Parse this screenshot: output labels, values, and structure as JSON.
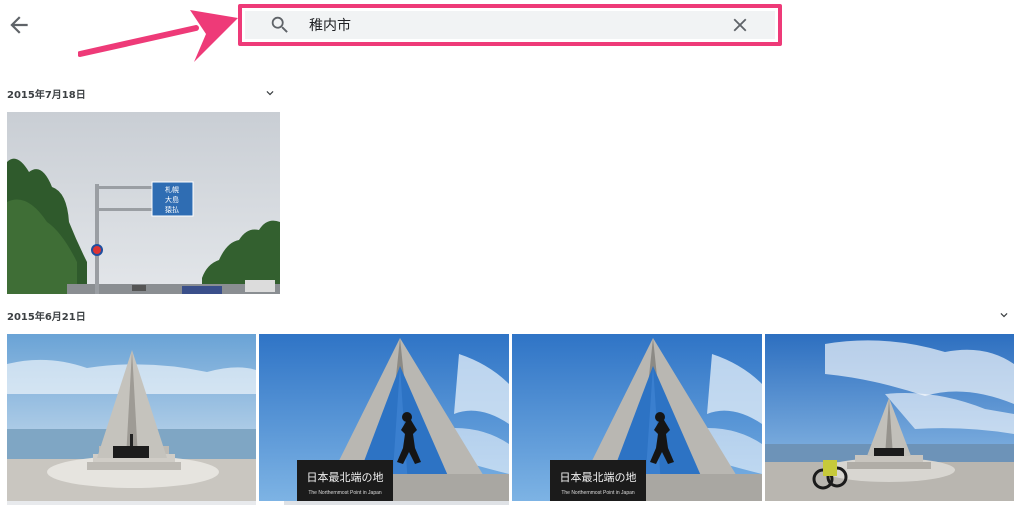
{
  "header": {
    "search": {
      "value": "稚内市",
      "placeholder": ""
    }
  },
  "groups": [
    {
      "date": "2015年7月18日"
    },
    {
      "date": "2015年6月21日"
    }
  ],
  "photos": {
    "sign": {
      "lines": [
        "札幌",
        "大島",
        "猿払"
      ]
    },
    "monument": {
      "plaque_title": "日本最北端の地",
      "plaque_subtitle": "The Northernmost Point in Japan"
    }
  },
  "colors": {
    "accent": "#ee3a78",
    "search_bg": "#f1f3f4",
    "sky": "#4a8ed8",
    "sign": "#2f6db3"
  },
  "icons": [
    "arrow-back-icon",
    "search-icon",
    "close-icon",
    "chevron-down-icon"
  ]
}
